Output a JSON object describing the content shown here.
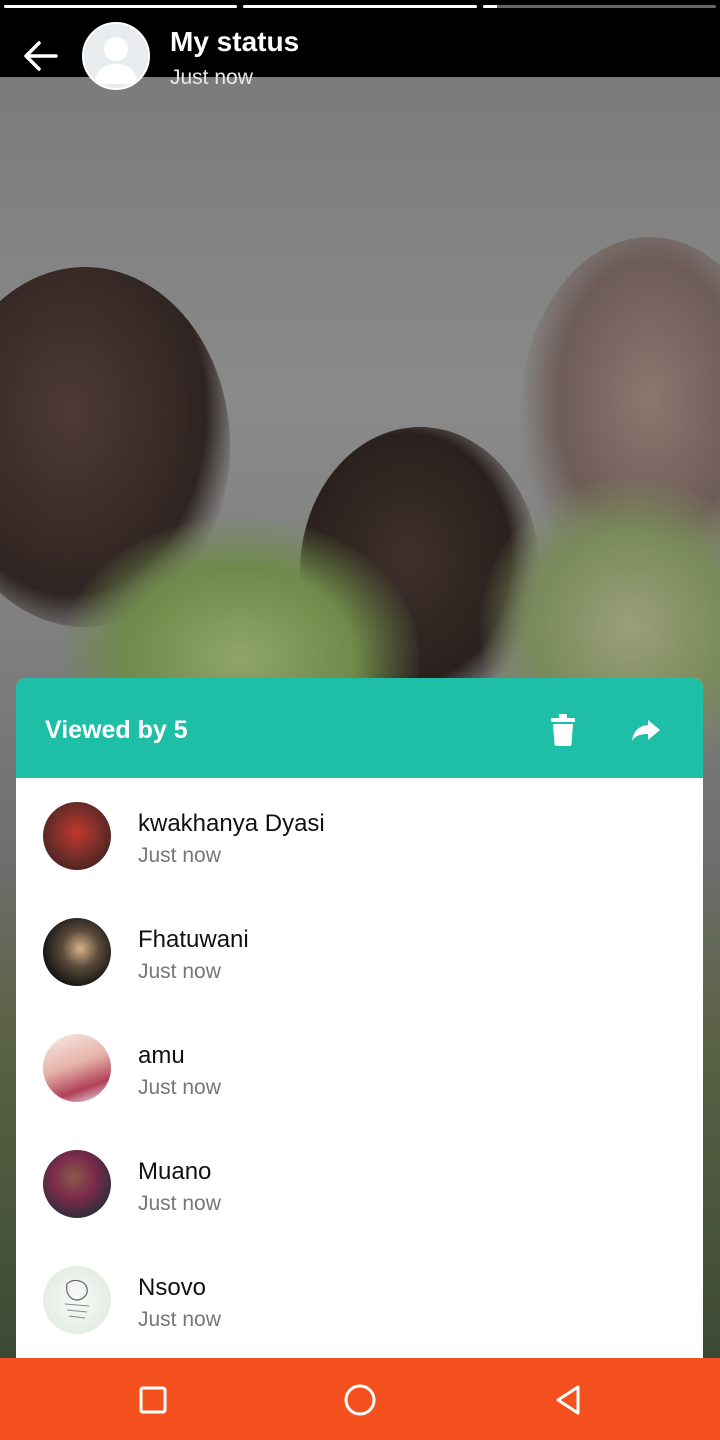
{
  "status_progress": [
    1.0,
    1.0,
    0.06
  ],
  "header": {
    "title": "My status",
    "subtitle": "Just now"
  },
  "sheet": {
    "title": "Viewed by 5",
    "accent_color": "#1fbfa7",
    "viewers": [
      {
        "name": "kwakhanya Dyasi",
        "time": "Just now",
        "avatar_color": "#7a2f2a"
      },
      {
        "name": "Fhatuwani",
        "time": "Just now",
        "avatar_color": "#2a2a2a"
      },
      {
        "name": "amu",
        "time": "Just now",
        "avatar_color": "#e9c9c2"
      },
      {
        "name": "Muano",
        "time": "Just now",
        "avatar_color": "#5a4a6a"
      },
      {
        "name": "Nsovo",
        "time": "Just now",
        "avatar_color": "#eef2ee"
      }
    ]
  },
  "nav": {
    "bar_color": "#f4511e",
    "icons": [
      "recents-square-icon",
      "home-circle-icon",
      "back-triangle-icon"
    ]
  }
}
